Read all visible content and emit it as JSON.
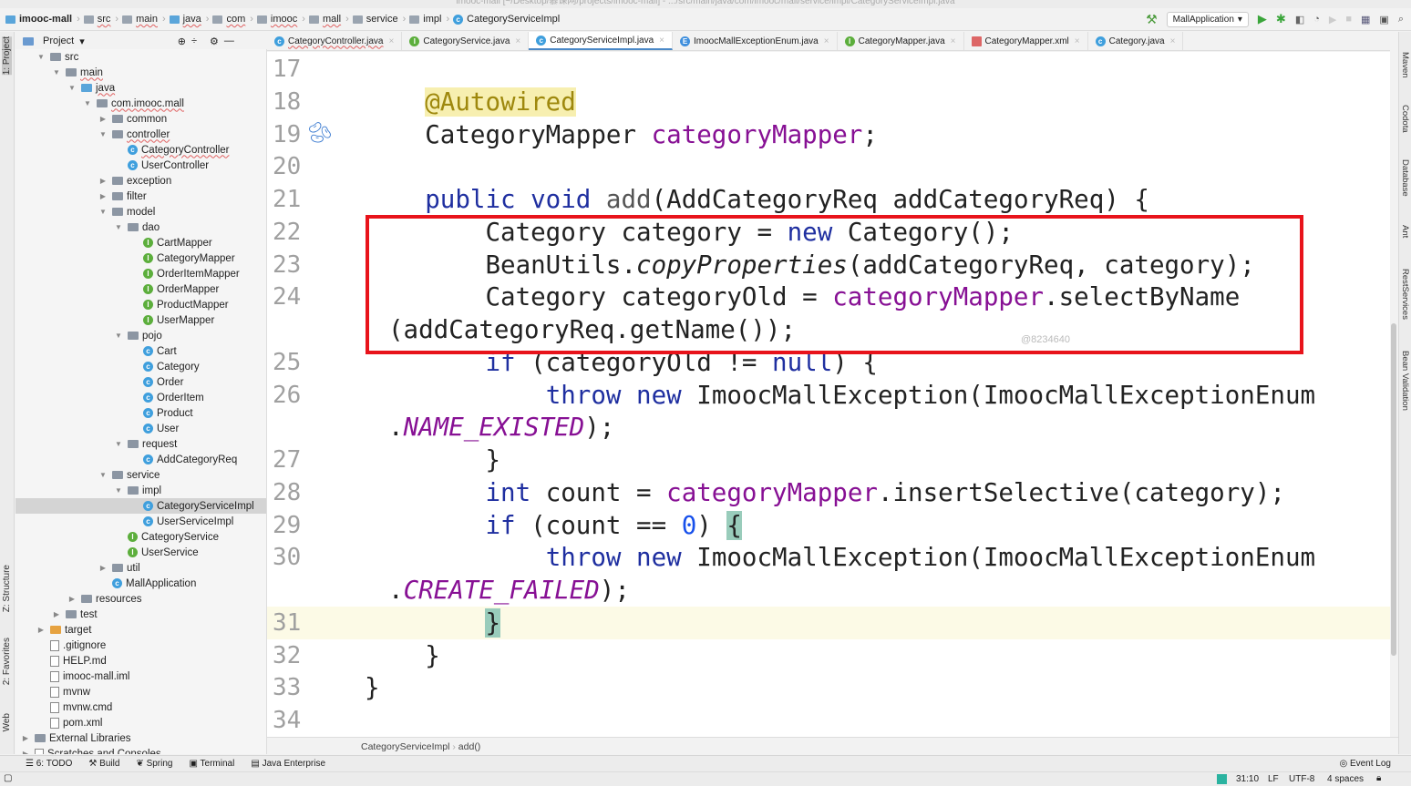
{
  "window": {
    "title": "imooc-mall [~/Desktop/慕课网/projects/imooc-mall] - .../src/main/java/com/imooc/mall/service/impl/CategoryServiceImpl.java"
  },
  "navbar": {
    "crumbs": [
      "imooc-mall",
      "src",
      "main",
      "java",
      "com",
      "imooc",
      "mall",
      "service",
      "impl",
      "CategoryServiceImpl"
    ]
  },
  "toolbar": {
    "run_config": "MallApplication"
  },
  "left_tools": [
    "1: Project",
    "Z: Structure",
    "2: Favorites",
    "Web"
  ],
  "right_tools": [
    "Maven",
    "Codota",
    "Database",
    "Ant",
    "RestServices",
    "Bean Validation"
  ],
  "project": {
    "header": "Project",
    "tree": [
      {
        "label": "src",
        "level": 1,
        "arrow": "▼",
        "icon": "folder"
      },
      {
        "label": "main",
        "level": 2,
        "arrow": "▼",
        "icon": "folder",
        "u": true
      },
      {
        "label": "java",
        "level": 3,
        "arrow": "▼",
        "icon": "folder-blue",
        "u": true
      },
      {
        "label": "com.imooc.mall",
        "level": 4,
        "arrow": "▼",
        "icon": "folder",
        "u": true
      },
      {
        "label": "common",
        "level": 5,
        "arrow": "▶",
        "icon": "folder"
      },
      {
        "label": "controller",
        "level": 5,
        "arrow": "▼",
        "icon": "folder",
        "u": true
      },
      {
        "label": "CategoryController",
        "level": 6,
        "icon": "class",
        "u": true
      },
      {
        "label": "UserController",
        "level": 6,
        "icon": "class"
      },
      {
        "label": "exception",
        "level": 5,
        "arrow": "▶",
        "icon": "folder"
      },
      {
        "label": "filter",
        "level": 5,
        "arrow": "▶",
        "icon": "folder"
      },
      {
        "label": "model",
        "level": 5,
        "arrow": "▼",
        "icon": "folder"
      },
      {
        "label": "dao",
        "level": 6,
        "arrow": "▼",
        "icon": "folder"
      },
      {
        "label": "CartMapper",
        "level": 7,
        "icon": "interface"
      },
      {
        "label": "CategoryMapper",
        "level": 7,
        "icon": "interface"
      },
      {
        "label": "OrderItemMapper",
        "level": 7,
        "icon": "interface"
      },
      {
        "label": "OrderMapper",
        "level": 7,
        "icon": "interface"
      },
      {
        "label": "ProductMapper",
        "level": 7,
        "icon": "interface"
      },
      {
        "label": "UserMapper",
        "level": 7,
        "icon": "interface"
      },
      {
        "label": "pojo",
        "level": 6,
        "arrow": "▼",
        "icon": "folder"
      },
      {
        "label": "Cart",
        "level": 7,
        "icon": "class"
      },
      {
        "label": "Category",
        "level": 7,
        "icon": "class"
      },
      {
        "label": "Order",
        "level": 7,
        "icon": "class"
      },
      {
        "label": "OrderItem",
        "level": 7,
        "icon": "class"
      },
      {
        "label": "Product",
        "level": 7,
        "icon": "class"
      },
      {
        "label": "User",
        "level": 7,
        "icon": "class"
      },
      {
        "label": "request",
        "level": 6,
        "arrow": "▼",
        "icon": "folder"
      },
      {
        "label": "AddCategoryReq",
        "level": 7,
        "icon": "class"
      },
      {
        "label": "service",
        "level": 5,
        "arrow": "▼",
        "icon": "folder"
      },
      {
        "label": "impl",
        "level": 6,
        "arrow": "▼",
        "icon": "folder"
      },
      {
        "label": "CategoryServiceImpl",
        "level": 7,
        "icon": "class",
        "selected": true
      },
      {
        "label": "UserServiceImpl",
        "level": 7,
        "icon": "class"
      },
      {
        "label": "CategoryService",
        "level": 6,
        "icon": "interface"
      },
      {
        "label": "UserService",
        "level": 6,
        "icon": "interface"
      },
      {
        "label": "util",
        "level": 5,
        "arrow": "▶",
        "icon": "folder"
      },
      {
        "label": "MallApplication",
        "level": 5,
        "icon": "class"
      },
      {
        "label": "resources",
        "level": 3,
        "arrow": "▶",
        "icon": "folder"
      },
      {
        "label": "test",
        "level": 2,
        "arrow": "▶",
        "icon": "folder"
      },
      {
        "label": "target",
        "level": 1,
        "arrow": "▶",
        "icon": "folder-orange"
      },
      {
        "label": ".gitignore",
        "level": 1,
        "icon": "file"
      },
      {
        "label": "HELP.md",
        "level": 1,
        "icon": "file"
      },
      {
        "label": "imooc-mall.iml",
        "level": 1,
        "icon": "file"
      },
      {
        "label": "mvnw",
        "level": 1,
        "icon": "file"
      },
      {
        "label": "mvnw.cmd",
        "level": 1,
        "icon": "file"
      },
      {
        "label": "pom.xml",
        "level": 1,
        "icon": "file"
      },
      {
        "label": "External Libraries",
        "level": 0,
        "arrow": "▶",
        "icon": "folder"
      },
      {
        "label": "Scratches and Consoles",
        "level": 0,
        "arrow": "▶",
        "icon": "file"
      }
    ]
  },
  "tabs": [
    {
      "label": "CategoryController.java",
      "icon": "class"
    },
    {
      "label": "CategoryService.java",
      "icon": "interface"
    },
    {
      "label": "CategoryServiceImpl.java",
      "icon": "class",
      "active": true
    },
    {
      "label": "ImoocMallExceptionEnum.java",
      "icon": "enum"
    },
    {
      "label": "CategoryMapper.java",
      "icon": "interface"
    },
    {
      "label": "CategoryMapper.xml",
      "icon": "xml"
    },
    {
      "label": "Category.java",
      "icon": "class"
    }
  ],
  "editor": {
    "lines": [
      {
        "n": "17",
        "t": []
      },
      {
        "n": "18",
        "t": [
          [
            "    ",
            ""
          ],
          [
            "@Autowired",
            "ann"
          ]
        ]
      },
      {
        "n": "19",
        "t": [
          [
            "    CategoryMapper ",
            ""
          ],
          [
            "categoryMapper",
            "fld"
          ],
          [
            ";",
            ""
          ]
        ]
      },
      {
        "n": "20",
        "t": []
      },
      {
        "n": "21",
        "t": [
          [
            "    ",
            ""
          ],
          [
            "public void ",
            "kw"
          ],
          [
            "add",
            "gray"
          ],
          [
            "(AddCategoryReq addCategoryReq) {",
            ""
          ]
        ]
      },
      {
        "n": "22",
        "t": [
          [
            "        Category category = ",
            ""
          ],
          [
            "new ",
            "kw"
          ],
          [
            "Category();",
            ""
          ]
        ]
      },
      {
        "n": "23",
        "t": [
          [
            "        BeanUtils.",
            ""
          ],
          [
            "copyProperties",
            "st"
          ],
          [
            "(addCategoryReq, category);",
            ""
          ]
        ]
      },
      {
        "n": "24",
        "t": [
          [
            "        Category categoryOld = ",
            ""
          ],
          [
            "categoryMapper",
            "fld"
          ],
          [
            ".selectByName",
            ""
          ]
        ]
      },
      {
        "n": "",
        "c": 1,
        "t": [
          [
            "(addCategoryReq.getName());",
            ""
          ]
        ]
      },
      {
        "n": "25",
        "t": [
          [
            "        ",
            ""
          ],
          [
            "if ",
            "kw"
          ],
          [
            "(categoryOld != ",
            ""
          ],
          [
            "null",
            "kw"
          ],
          [
            ") {",
            ""
          ]
        ]
      },
      {
        "n": "26",
        "t": [
          [
            "            ",
            ""
          ],
          [
            "throw new ",
            "kw"
          ],
          [
            "ImoocMallException(ImoocMallExceptionEnum",
            ""
          ]
        ]
      },
      {
        "n": "",
        "c": 1,
        "t": [
          [
            ".",
            ""
          ],
          [
            "NAME_EXISTED",
            "en"
          ],
          [
            ");",
            ""
          ]
        ]
      },
      {
        "n": "27",
        "t": [
          [
            "        }",
            ""
          ]
        ]
      },
      {
        "n": "28",
        "t": [
          [
            "        ",
            ""
          ],
          [
            "int ",
            "kw"
          ],
          [
            "count = ",
            ""
          ],
          [
            "categoryMapper",
            "fld"
          ],
          [
            ".insertSelective(category);",
            ""
          ]
        ]
      },
      {
        "n": "29",
        "t": [
          [
            "        ",
            ""
          ],
          [
            "if ",
            "kw"
          ],
          [
            "(count == ",
            ""
          ],
          [
            "0",
            "num"
          ],
          [
            ") ",
            ""
          ],
          [
            "{",
            "brh"
          ]
        ]
      },
      {
        "n": "30",
        "t": [
          [
            "            ",
            ""
          ],
          [
            "throw new ",
            "kw"
          ],
          [
            "ImoocMallException(ImoocMallExceptionEnum",
            ""
          ]
        ]
      },
      {
        "n": "",
        "c": 1,
        "t": [
          [
            ".",
            ""
          ],
          [
            "CREATE_FAILED",
            "en"
          ],
          [
            ");",
            ""
          ]
        ]
      },
      {
        "n": "31",
        "cur": true,
        "t": [
          [
            "        ",
            ""
          ],
          [
            "}",
            "brh"
          ]
        ]
      },
      {
        "n": "32",
        "t": [
          [
            "    }",
            ""
          ]
        ]
      },
      {
        "n": "33",
        "t": [
          [
            "}",
            ""
          ]
        ]
      },
      {
        "n": "34",
        "t": []
      }
    ],
    "watermark": "@8234640"
  },
  "breadcrumb": [
    "CategoryServiceImpl",
    "add()"
  ],
  "bottom_tools": [
    "6: TODO",
    "Build",
    "Spring",
    "Terminal",
    "Java Enterprise"
  ],
  "event_log": "Event Log",
  "status": {
    "position": "31:10",
    "line_sep": "LF",
    "encoding": "UTF-8",
    "indent": "4 spaces"
  }
}
